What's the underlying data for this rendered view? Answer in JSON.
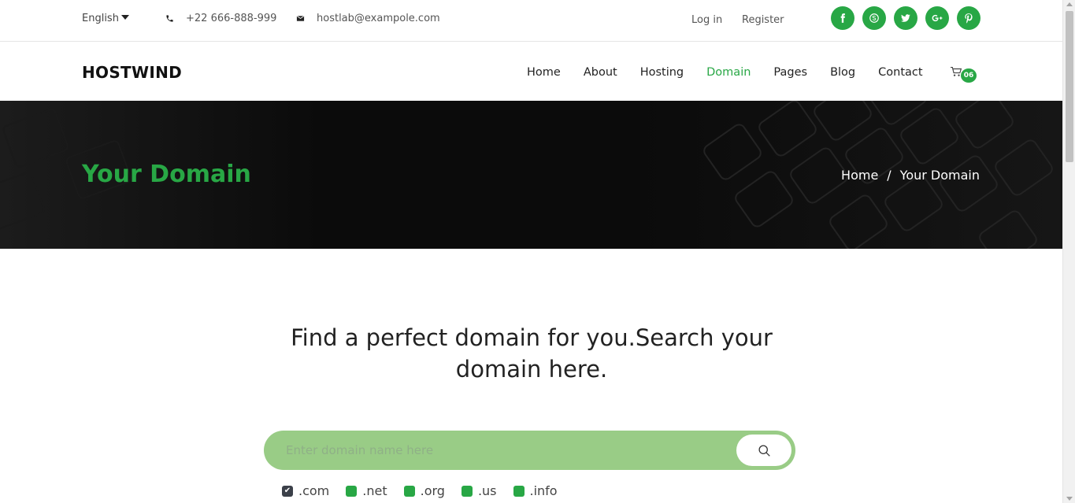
{
  "topbar": {
    "language": "English",
    "phone": "+22 666-888-999",
    "email": "hostlab@exampole.com",
    "login": "Log in",
    "register": "Register",
    "socials": [
      "facebook",
      "skype",
      "twitter",
      "google-plus",
      "pinterest"
    ]
  },
  "nav": {
    "logo": "HOSTWIND",
    "items": [
      "Home",
      "About",
      "Hosting",
      "Domain",
      "Pages",
      "Blog",
      "Contact"
    ],
    "active": "Domain",
    "cart_count": "06"
  },
  "hero": {
    "title": "Your Domain",
    "breadcrumb": [
      "Home",
      "/",
      "Your Domain"
    ]
  },
  "main": {
    "headline": "Find a perfect domain for you.Search your domain here.",
    "search_placeholder": "Enter domain name here",
    "tlds": [
      ".com",
      ".net",
      ".org",
      ".us",
      ".info"
    ],
    "tld_checked": ".com"
  },
  "colors": {
    "accent": "#28a745",
    "search_bg": "#99cc86",
    "hero_bg": "#0c0c0c"
  }
}
